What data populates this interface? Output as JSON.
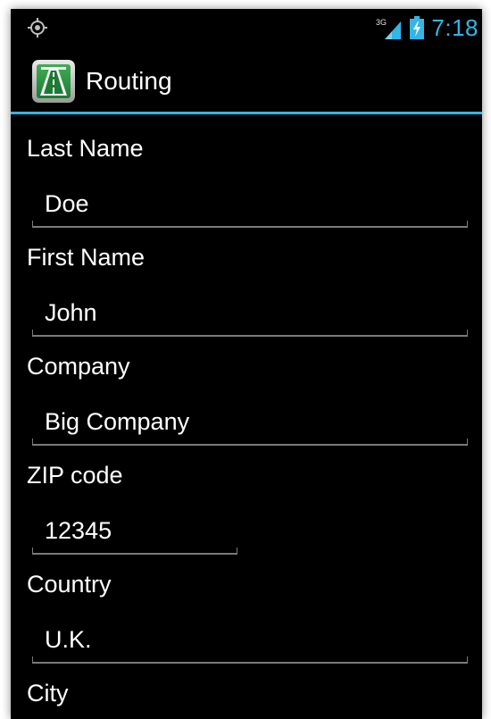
{
  "status_bar": {
    "network_label": "3G",
    "time": "7:18",
    "left_icon": "gps-icon",
    "signal_icon": "signal-3g-icon",
    "battery_icon": "battery-charging-icon",
    "accent_color": "#33b5e5"
  },
  "action_bar": {
    "title": "Routing",
    "icon": "highway-app-icon"
  },
  "form": {
    "fields": [
      {
        "label": "Last Name",
        "value": "Doe"
      },
      {
        "label": "First Name",
        "value": "John"
      },
      {
        "label": "Company",
        "value": "Big Company"
      },
      {
        "label": "ZIP code",
        "value": "12345"
      },
      {
        "label": "Country",
        "value": "U.K."
      },
      {
        "label": "City",
        "value": ""
      }
    ]
  }
}
